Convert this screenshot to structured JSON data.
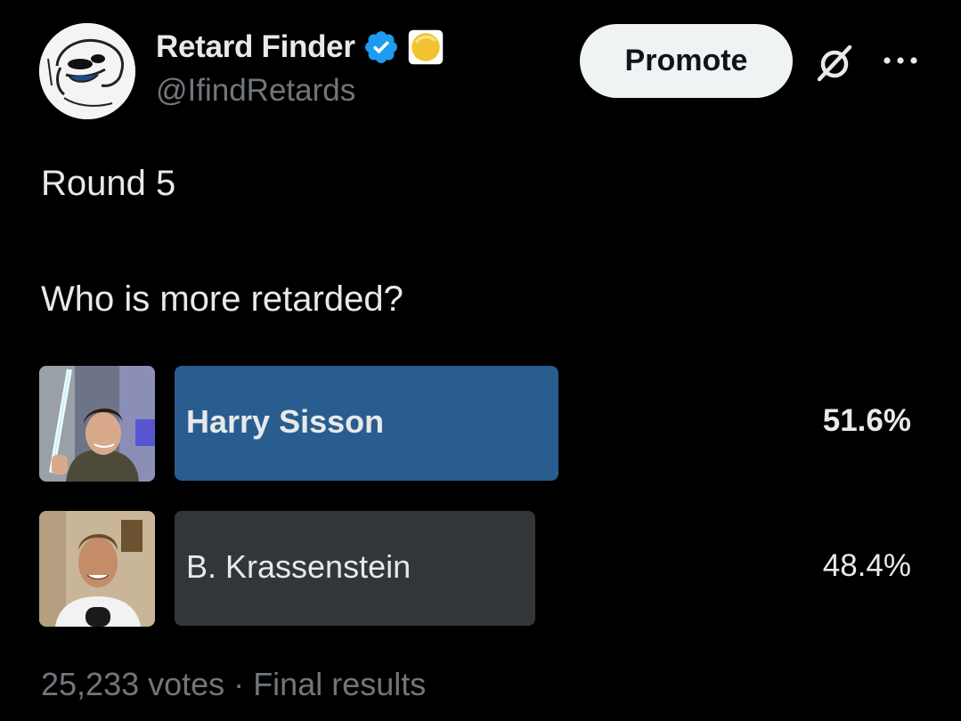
{
  "author": {
    "display_name": "Retard Finder",
    "handle": "@IfindRetards",
    "avatar_icon": "cartoon-face-avatar",
    "verified_color": "#1d9bf0"
  },
  "header": {
    "promote_label": "Promote",
    "grok_icon": "grok-icon",
    "more_icon": "more-dots-icon"
  },
  "tweet": {
    "line1": "Round 5",
    "line2": "Who is more retarded?"
  },
  "poll": {
    "options": [
      {
        "label": "Harry Sisson",
        "percent": "51.6%",
        "fraction": 0.516,
        "winner": true,
        "bar_color": "#2a5d8f"
      },
      {
        "label": "B. Krassenstein",
        "percent": "48.4%",
        "fraction": 0.484,
        "winner": false,
        "bar_color": "#333639"
      }
    ],
    "votes": "25,233 votes",
    "separator": "·",
    "status": "Final results"
  }
}
